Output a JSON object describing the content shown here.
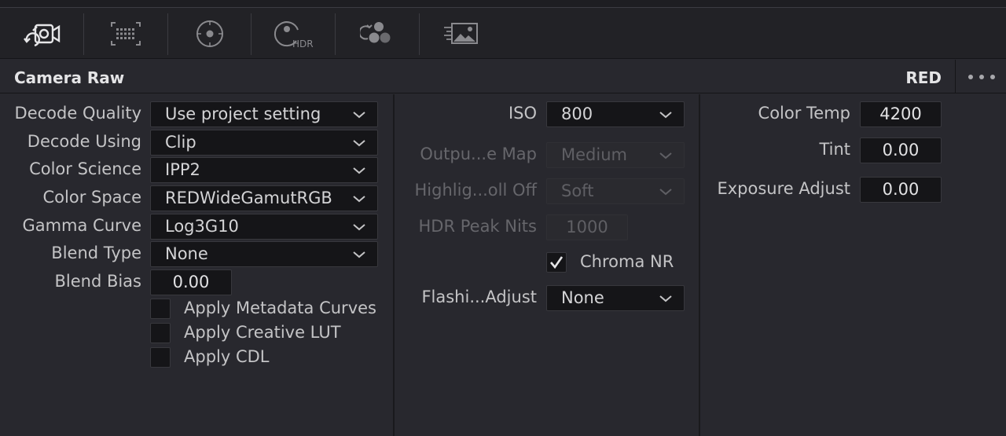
{
  "toolbar": {
    "tools": [
      {
        "name": "camera-raw-tool",
        "icon": "camera-raw-icon",
        "active": true
      },
      {
        "name": "color-chart-tool",
        "icon": "color-chart-icon",
        "active": false
      },
      {
        "name": "color-wheels-tool",
        "icon": "color-wheels-icon",
        "active": false
      },
      {
        "name": "hdr-wheels-tool",
        "icon": "hdr-wheels-icon",
        "active": false,
        "badge": "HDR"
      },
      {
        "name": "rgb-mixer-tool",
        "icon": "rgb-mixer-icon",
        "active": false
      },
      {
        "name": "motion-effects-tool",
        "icon": "motion-effects-icon",
        "active": false
      }
    ]
  },
  "header": {
    "title": "Camera Raw",
    "format": "RED",
    "more_icon": "more-options-icon"
  },
  "left": {
    "fields": [
      {
        "label": "Decode Quality",
        "value": "Use project setting"
      },
      {
        "label": "Decode Using",
        "value": "Clip"
      },
      {
        "label": "Color Science",
        "value": "IPP2"
      },
      {
        "label": "Color Space",
        "value": "REDWideGamutRGB"
      },
      {
        "label": "Gamma Curve",
        "value": "Log3G10"
      },
      {
        "label": "Blend Type",
        "value": "None"
      }
    ],
    "blend_bias": {
      "label": "Blend Bias",
      "value": "0.00"
    },
    "checkboxes": [
      {
        "label": "Apply Metadata Curves",
        "checked": false
      },
      {
        "label": "Apply Creative LUT",
        "checked": false
      },
      {
        "label": "Apply CDL",
        "checked": false
      }
    ]
  },
  "middle": {
    "iso": {
      "label": "ISO",
      "value": "800"
    },
    "output_tone_map": {
      "label": "Outpu...e Map",
      "value": "Medium",
      "enabled": false
    },
    "highlight_rolloff": {
      "label": "Highlig...oll Off",
      "value": "Soft",
      "enabled": false
    },
    "hdr_peak_nits": {
      "label": "HDR Peak Nits",
      "value": "1000",
      "enabled": false
    },
    "chroma_nr": {
      "label": "Chroma NR",
      "checked": true
    },
    "flashing_adjust": {
      "label": "Flashi...Adjust",
      "value": "None"
    }
  },
  "right": {
    "color_temp": {
      "label": "Color Temp",
      "value": "4200"
    },
    "tint": {
      "label": "Tint",
      "value": "0.00"
    },
    "exposure_adjust": {
      "label": "Exposure Adjust",
      "value": "0.00"
    }
  },
  "colors": {
    "panel_bg": "#28282e",
    "field_bg": "#151518",
    "label_text": "#c4c4c6",
    "disabled_text": "#66666b"
  }
}
